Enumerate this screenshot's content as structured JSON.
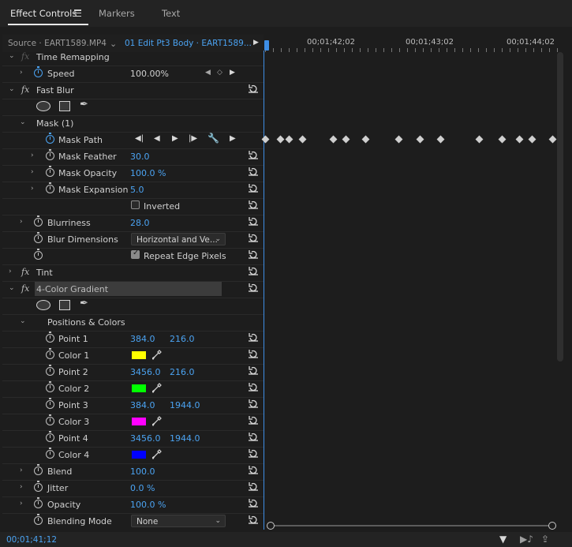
{
  "tabs": [
    {
      "label": "Effect Controls",
      "active": true
    },
    {
      "label": "Markers",
      "active": false
    },
    {
      "label": "Text",
      "active": false
    }
  ],
  "header": {
    "source": "Source · EART1589.MP4",
    "clip": "01 Edit Pt3 Body · EART1589..."
  },
  "ruler": {
    "timecodes": [
      "00;01;42;02",
      "00;01;43;02",
      "00;01;44;02"
    ]
  },
  "rows": {
    "time_remapping": "Time Remapping",
    "speed": {
      "label": "Speed",
      "value": "100.00%"
    },
    "fast_blur": "Fast Blur",
    "mask": "Mask (1)",
    "mask_path": "Mask Path",
    "mask_feather": {
      "label": "Mask Feather",
      "value": "30.0"
    },
    "mask_opacity": {
      "label": "Mask Opacity",
      "value": "100.0 %"
    },
    "mask_expansion": {
      "label": "Mask Expansion",
      "value": "5.0"
    },
    "inverted": {
      "label": "Inverted",
      "checked": false
    },
    "blurriness": {
      "label": "Blurriness",
      "value": "28.0"
    },
    "blur_dimensions": {
      "label": "Blur Dimensions",
      "value": "Horizontal and Ve..."
    },
    "repeat_edge": {
      "label": "Repeat Edge Pixels",
      "checked": true
    },
    "tint": "Tint",
    "four_color": "4-Color Gradient",
    "positions_colors": "Positions & Colors",
    "point1": {
      "label": "Point 1",
      "x": "384.0",
      "y": "216.0"
    },
    "color1": {
      "label": "Color 1",
      "color": "#ffff00"
    },
    "point2": {
      "label": "Point 2",
      "x": "3456.0",
      "y": "216.0"
    },
    "color2": {
      "label": "Color 2",
      "color": "#00ff00"
    },
    "point3": {
      "label": "Point 3",
      "x": "384.0",
      "y": "1944.0"
    },
    "color3": {
      "label": "Color 3",
      "color": "#ff00ff"
    },
    "point4": {
      "label": "Point 4",
      "x": "3456.0",
      "y": "1944.0"
    },
    "color4": {
      "label": "Color 4",
      "color": "#0000ff"
    },
    "blend": {
      "label": "Blend",
      "value": "100.0"
    },
    "jitter": {
      "label": "Jitter",
      "value": "0.0 %"
    },
    "opacity": {
      "label": "Opacity",
      "value": "100.0 %"
    },
    "blending_mode": {
      "label": "Blending Mode",
      "value": "None"
    }
  },
  "status": {
    "timecode": "00;01;41;12"
  },
  "icons": {
    "menu": "hamburger-menu-icon",
    "stopwatch": "stopwatch-icon",
    "reset": "reset-parameter-icon",
    "dropper": "eyedropper-icon",
    "filter": "filter-icon"
  },
  "colors": {
    "accent": "#4ba3f2",
    "background": "#1d1d1d"
  }
}
